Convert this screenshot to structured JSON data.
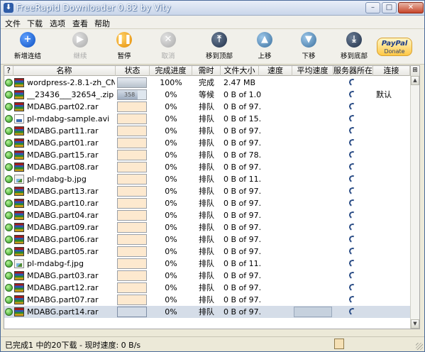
{
  "window": {
    "title": "FreeRapid Downloader 0.82 by Vity",
    "minimize_glyph": "–",
    "maximize_glyph": "□",
    "close_glyph": "✕"
  },
  "menu": [
    "文件",
    "下载",
    "选项",
    "查看",
    "帮助"
  ],
  "toolbar": {
    "buttons": [
      {
        "label": "新增连结",
        "icon": "plus-icon",
        "color": "blue",
        "glyph": "+",
        "enabled": true
      },
      {
        "label": "继续",
        "icon": "play-icon",
        "color": "gray",
        "glyph": "▶",
        "enabled": false
      },
      {
        "label": "暂停",
        "icon": "pause-icon",
        "color": "orange",
        "glyph": "❚❚",
        "enabled": true
      },
      {
        "label": "取消",
        "icon": "cancel-icon",
        "color": "gray",
        "glyph": "✕",
        "enabled": false
      },
      {
        "label": "移到顶部",
        "icon": "move-top-icon",
        "color": "dark",
        "glyph": "⤒",
        "enabled": true
      },
      {
        "label": "上移",
        "icon": "move-up-icon",
        "color": "teal",
        "glyph": "▲",
        "enabled": true
      },
      {
        "label": "下移",
        "icon": "move-down-icon",
        "color": "teal",
        "glyph": "▼",
        "enabled": true
      },
      {
        "label": "移到底部",
        "icon": "move-bottom-icon",
        "color": "dark",
        "glyph": "⤓",
        "enabled": true
      }
    ],
    "paypal": {
      "brand": "PayPal",
      "label": "Donate"
    }
  },
  "table": {
    "columns": [
      "?",
      "名称",
      "状态",
      "完成进度",
      "需时",
      "文件大小",
      "速度",
      "平均速度",
      "服务器所在",
      "连接"
    ],
    "rows": [
      {
        "name": "wordpress-2.8.1-zh_CN_...",
        "file_icon": "rar",
        "status": "done",
        "progress": "100%",
        "time": "完成",
        "size": "2.47 MB",
        "connection": ""
      },
      {
        "name": "__23436___32654_.zip",
        "file_icon": "rar",
        "status": "queued",
        "status_text": "358",
        "progress": "0%",
        "time": "等候",
        "size": "0 B of 1.0...",
        "connection": "默认"
      },
      {
        "name": "MDABG.part02.rar",
        "file_icon": "rar",
        "status": "waiting",
        "progress": "0%",
        "time": "排队",
        "size": "0 B of 97...",
        "connection": ""
      },
      {
        "name": "pl-mdabg-sample.avi",
        "file_icon": "avi",
        "status": "waiting",
        "progress": "0%",
        "time": "排队",
        "size": "0 B of 15...",
        "connection": ""
      },
      {
        "name": "MDABG.part11.rar",
        "file_icon": "rar",
        "status": "waiting",
        "progress": "0%",
        "time": "排队",
        "size": "0 B of 97...",
        "connection": ""
      },
      {
        "name": "MDABG.part01.rar",
        "file_icon": "rar",
        "status": "waiting",
        "progress": "0%",
        "time": "排队",
        "size": "0 B of 97...",
        "connection": ""
      },
      {
        "name": "MDABG.part15.rar",
        "file_icon": "rar",
        "status": "waiting",
        "progress": "0%",
        "time": "排队",
        "size": "0 B of 78...",
        "connection": ""
      },
      {
        "name": "MDABG.part08.rar",
        "file_icon": "rar",
        "status": "waiting",
        "progress": "0%",
        "time": "排队",
        "size": "0 B of 97...",
        "connection": ""
      },
      {
        "name": "pl-mdabg-b.jpg",
        "file_icon": "img",
        "status": "waiting",
        "progress": "0%",
        "time": "排队",
        "size": "0 B of 11...",
        "connection": ""
      },
      {
        "name": "MDABG.part13.rar",
        "file_icon": "rar",
        "status": "waiting",
        "progress": "0%",
        "time": "排队",
        "size": "0 B of 97...",
        "connection": ""
      },
      {
        "name": "MDABG.part10.rar",
        "file_icon": "rar",
        "status": "waiting",
        "progress": "0%",
        "time": "排队",
        "size": "0 B of 97...",
        "connection": ""
      },
      {
        "name": "MDABG.part04.rar",
        "file_icon": "rar",
        "status": "waiting",
        "progress": "0%",
        "time": "排队",
        "size": "0 B of 97...",
        "connection": ""
      },
      {
        "name": "MDABG.part09.rar",
        "file_icon": "rar",
        "status": "waiting",
        "progress": "0%",
        "time": "排队",
        "size": "0 B of 97...",
        "connection": ""
      },
      {
        "name": "MDABG.part06.rar",
        "file_icon": "rar",
        "status": "waiting",
        "progress": "0%",
        "time": "排队",
        "size": "0 B of 97...",
        "connection": ""
      },
      {
        "name": "MDABG.part05.rar",
        "file_icon": "rar",
        "status": "waiting",
        "progress": "0%",
        "time": "排队",
        "size": "0 B of 97...",
        "connection": ""
      },
      {
        "name": "pl-mdabg-f.jpg",
        "file_icon": "img",
        "status": "waiting",
        "progress": "0%",
        "time": "排队",
        "size": "0 B of 11...",
        "connection": ""
      },
      {
        "name": "MDABG.part03.rar",
        "file_icon": "rar",
        "status": "waiting",
        "progress": "0%",
        "time": "排队",
        "size": "0 B of 97...",
        "connection": ""
      },
      {
        "name": "MDABG.part12.rar",
        "file_icon": "rar",
        "status": "waiting",
        "progress": "0%",
        "time": "排队",
        "size": "0 B of 97...",
        "connection": ""
      },
      {
        "name": "MDABG.part07.rar",
        "file_icon": "rar",
        "status": "waiting",
        "progress": "0%",
        "time": "排队",
        "size": "0 B of 97...",
        "connection": ""
      },
      {
        "name": "MDABG.part14.rar",
        "file_icon": "rar",
        "status": "selected",
        "progress": "0%",
        "time": "排队",
        "size": "0 B of 97...",
        "connection": "",
        "selected": true
      }
    ]
  },
  "statusbar": {
    "text": "已完成1 中的20下载 - 现时速度: 0 B/s"
  },
  "colors": {
    "waiting_fill": "#fde9cf",
    "selected_row": "#d5dde8",
    "progress_done": "#b7c1cc"
  }
}
